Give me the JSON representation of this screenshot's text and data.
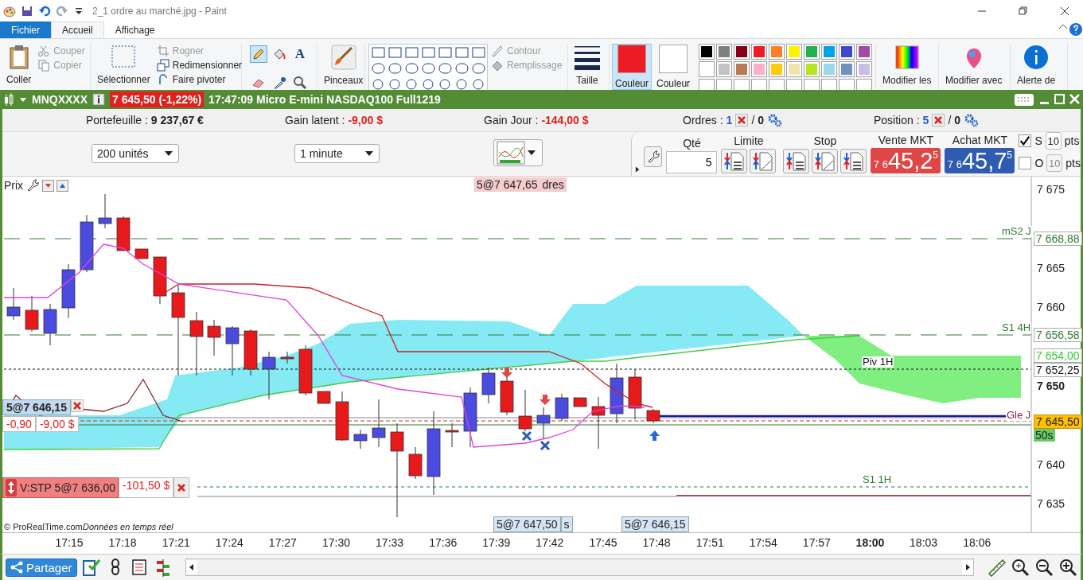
{
  "paint": {
    "title": "2_1 ordre au marché.jpg - Paint",
    "tabs": [
      {
        "label": "Fichier",
        "selected": false,
        "kind": "file"
      },
      {
        "label": "Accueil",
        "selected": true,
        "kind": "tab"
      },
      {
        "label": "Affichage",
        "selected": false,
        "kind": "tab"
      }
    ],
    "paste": "Coller",
    "clipboard": [
      {
        "label": "Couper",
        "disabled": true
      },
      {
        "label": "Copier",
        "disabled": true
      }
    ],
    "select": "Sélectionner",
    "image": [
      {
        "label": "Rogner",
        "disabled": true
      },
      {
        "label": "Redimensionner",
        "disabled": false
      },
      {
        "label": "Faire pivoter",
        "disabled": false
      }
    ],
    "tools": [
      {
        "kind": "pencil",
        "selected": true
      },
      {
        "kind": "fill",
        "selected": false
      },
      {
        "kind": "text",
        "selected": false,
        "glyph": "A"
      },
      {
        "kind": "eraser",
        "selected": false
      },
      {
        "kind": "picker",
        "selected": false
      },
      {
        "kind": "magnifier",
        "selected": false
      }
    ],
    "brushes": "Pinceaux",
    "shape_options": [
      {
        "label": "Contour",
        "disabled": true
      },
      {
        "label": "Remplissage",
        "disabled": true
      }
    ],
    "size": "Taille",
    "colors": [
      {
        "label": "Couleur",
        "selected": true,
        "color": "#ed1c24"
      },
      {
        "label": "Couleur",
        "selected": false,
        "color": "#ffffff"
      }
    ],
    "palette": [
      {
        "color": "#000000"
      },
      {
        "color": "#7f7f7f"
      },
      {
        "color": "#880015"
      },
      {
        "color": "#ed1c24"
      },
      {
        "color": "#ff7f27"
      },
      {
        "color": "#fff200"
      },
      {
        "color": "#22b14c"
      },
      {
        "color": "#00a2e8"
      },
      {
        "color": "#3f48cc"
      },
      {
        "color": "#a349a4"
      },
      {
        "color": "#ffffff"
      },
      {
        "color": "#c3c3c3"
      },
      {
        "color": "#b97a57"
      },
      {
        "color": "#ffaec9"
      },
      {
        "color": "#ffc90e"
      },
      {
        "color": "#efe4b0"
      },
      {
        "color": "#b5e61d"
      },
      {
        "color": "#99d9ea"
      },
      {
        "color": "#7092be"
      },
      {
        "color": "#c8bfe7"
      }
    ],
    "edit_colors": "Modifier les",
    "paint3d": "Modifier avec",
    "alert": "Alerte de"
  },
  "platform": {
    "symbol": "MNQXXXX",
    "price_badge": "7 645,50 (-1,22%)",
    "title": "17:47:09 Micro E-mini NASDAQ100 Full1219",
    "account": [
      {
        "label": "Portefeuille :",
        "value": "9 237,67 €",
        "kind": "neutral"
      },
      {
        "label": "Gain latent :",
        "value": "-9,00 $",
        "kind": "negative"
      },
      {
        "label": "Gain Jour :",
        "value": "-144,00 $",
        "kind": "negative"
      }
    ],
    "counters": [
      {
        "label": "Ordres :",
        "count": "1",
        "separator": "/",
        "other": "0"
      },
      {
        "label": "Position :",
        "count": "5",
        "separator": "/",
        "other": "0"
      }
    ],
    "selectors": [
      {
        "value": "200 unités"
      },
      {
        "value": "1 minute"
      }
    ],
    "order_panel": {
      "qty_label": "Qté",
      "qty": "5",
      "limit_label": "Limite",
      "stop_label": "Stop",
      "sell": {
        "label": "Vente MKT",
        "prefix": "7 6",
        "big": "45,2",
        "sup": "5"
      },
      "buy": {
        "label": "Achat MKT",
        "prefix": "7 6",
        "big": "45,7",
        "sup": "5"
      },
      "options": [
        {
          "label": "S",
          "checked": true,
          "value": "10",
          "disabled": false,
          "unit": "pts"
        },
        {
          "label": "O",
          "checked": false,
          "value": "10",
          "disabled": true,
          "unit": "pts"
        }
      ]
    },
    "chart": {
      "price_label": "Prix",
      "top_order": "5@7 647,65",
      "top_order_tail": "dres",
      "axis": [
        {
          "label": "7 675",
          "kind": "tick"
        },
        {
          "label": "7 665",
          "kind": "tick"
        },
        {
          "label": "7 660",
          "kind": "tick"
        },
        {
          "label": "7 650",
          "kind": "bold"
        },
        {
          "label": "7 640",
          "kind": "tick"
        },
        {
          "label": "7 635",
          "kind": "tick"
        }
      ],
      "boxes": [
        {
          "label": "7 668,88",
          "kind": "box",
          "color": "#2e7d32"
        },
        {
          "label": "7 656,58",
          "kind": "box",
          "color": "#2e7d32"
        },
        {
          "label": "7 654,00",
          "kind": "box",
          "color": "#33cc33"
        },
        {
          "label": "7 652,25",
          "kind": "box",
          "color": "#111111"
        },
        {
          "label": "7 645,50",
          "kind": "current",
          "color": "#ffc000"
        },
        {
          "label": "50s",
          "kind": "timer",
          "color": "#66cc66"
        }
      ],
      "levels": [
        {
          "label": "mS2 J",
          "color": "#2e7d32"
        },
        {
          "label": "S1 4H",
          "color": "#2e7d32"
        },
        {
          "label": "Piv 1H",
          "color": "#111111"
        },
        {
          "label": "Gle J",
          "color": "#8b1a4a"
        },
        {
          "label": "S1 1H",
          "color": "#2e7d32"
        }
      ],
      "position": {
        "label": "5@7 646,15",
        "points": "-0,90",
        "amount": "-9,00 $"
      },
      "stop": {
        "label": "V:STP 5@7 636,00",
        "amount": "-101,50 $"
      },
      "bottom_tags": [
        {
          "label": "5@7 647,50",
          "tail": "s"
        },
        {
          "label": "5@7 646,15"
        }
      ],
      "copyright": "© ProRealTime.com",
      "realtime": "Données en temps réel",
      "times": [
        {
          "label": "17:15",
          "emphasized": false
        },
        {
          "label": "17:18",
          "emphasized": false
        },
        {
          "label": "17:21",
          "emphasized": false
        },
        {
          "label": "17:24",
          "emphasized": false
        },
        {
          "label": "17:27",
          "emphasized": false
        },
        {
          "label": "17:30",
          "emphasized": false
        },
        {
          "label": "17:33",
          "emphasized": false
        },
        {
          "label": "17:36",
          "emphasized": false
        },
        {
          "label": "17:39",
          "emphasized": false
        },
        {
          "label": "17:42",
          "emphasized": false
        },
        {
          "label": "17:45",
          "emphasized": false
        },
        {
          "label": "17:48",
          "emphasized": false
        },
        {
          "label": "17:51",
          "emphasized": false
        },
        {
          "label": "17:54",
          "emphasized": false
        },
        {
          "label": "17:57",
          "emphasized": false
        },
        {
          "label": "18:00",
          "emphasized": true
        },
        {
          "label": "18:03",
          "emphasized": false
        },
        {
          "label": "18:06",
          "emphasized": false
        }
      ]
    },
    "share": "Partager"
  }
}
